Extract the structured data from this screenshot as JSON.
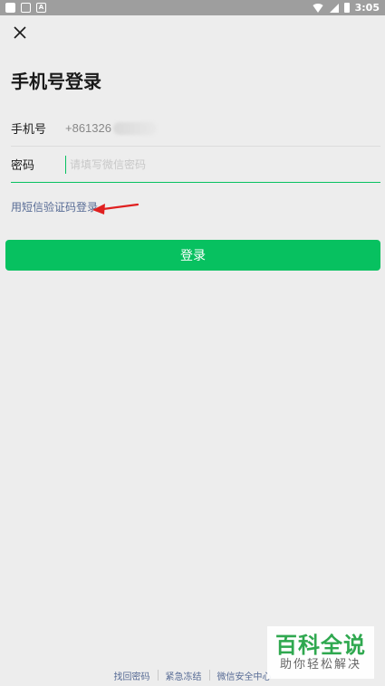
{
  "status_bar": {
    "time": "3:05",
    "icons": [
      "app-icon",
      "image-icon",
      "a-icon",
      "wifi-icon",
      "signal-icon",
      "battery-icon"
    ]
  },
  "header": {
    "close_icon": "close-icon",
    "title": "手机号登录"
  },
  "form": {
    "phone": {
      "label": "手机号",
      "value": "+861326"
    },
    "password": {
      "label": "密码",
      "value": "",
      "placeholder": "请填写微信密码"
    }
  },
  "sms_login_link": "用短信验证码登录",
  "login_button": "登录",
  "footer": {
    "links": [
      "找回密码",
      "紧急冻结",
      "微信安全中心"
    ]
  },
  "watermark": {
    "main": "百科全说",
    "sub": "助你轻松解决"
  },
  "colors": {
    "accent_green": "#07c160",
    "link_blue": "#576b95",
    "background": "#ededed",
    "annotation_arrow": "#e02020"
  }
}
